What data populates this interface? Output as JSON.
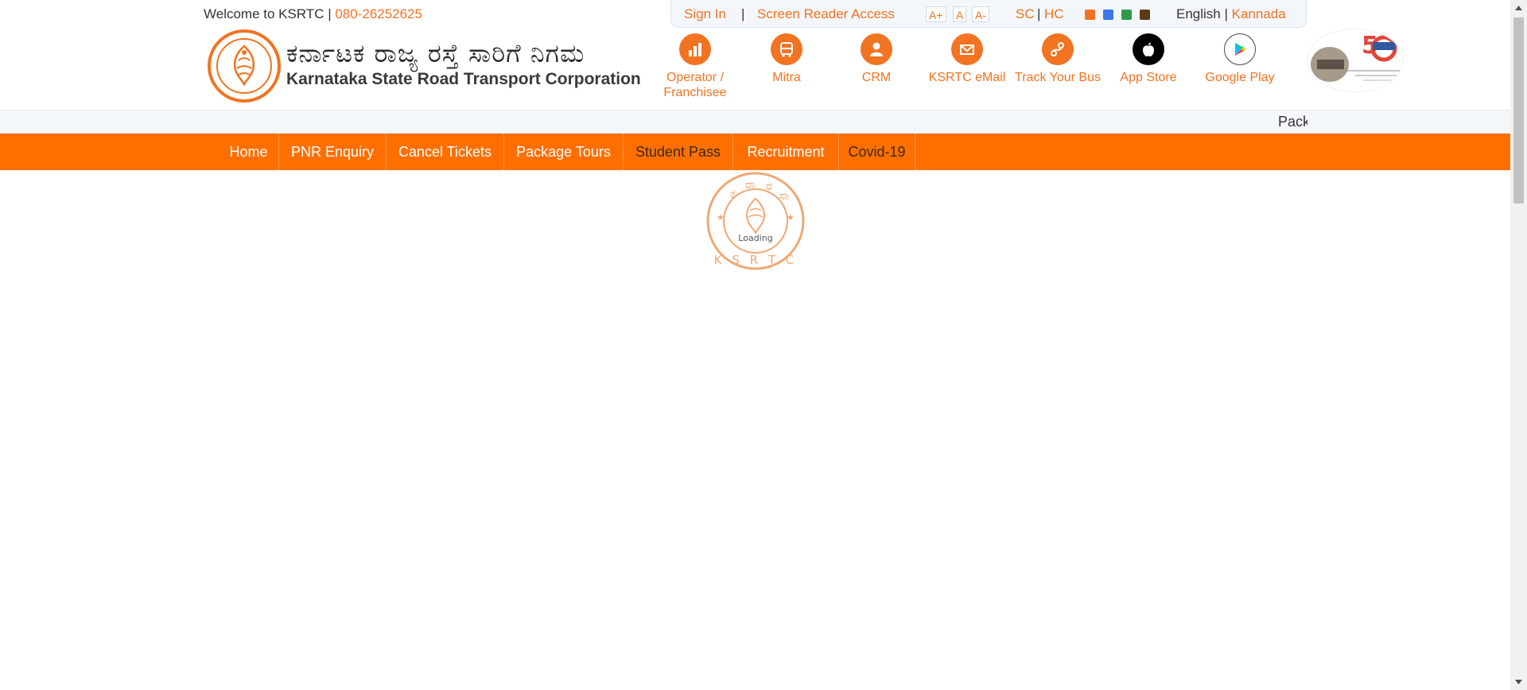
{
  "topbar": {
    "welcome": "Welcome to KSRTC | ",
    "phone": "080-26252625"
  },
  "utility": {
    "sign_in": "Sign In",
    "separator": "|",
    "screen_reader": "Screen Reader Access",
    "font_increase": "A+",
    "font_normal": "A",
    "font_decrease": "A-",
    "sc": "SC",
    "sep2": "|",
    "hc": "HC",
    "theme_colors": [
      "#f27321",
      "#3b78e7",
      "#2e9a4a",
      "#5a3a14"
    ],
    "lang_english": "English",
    "lang_sep": " | ",
    "lang_kannada": "Kannada"
  },
  "brand": {
    "name_kannada": "ಕರ್ನಾಟಕ ರಾಜ್ಯ ರಸ್ತೆ ಸಾರಿಗೆ ನಿಗಮ",
    "name_english": "Karnataka State Road Transport Corporation",
    "logo_text": "K. S. R. T. C."
  },
  "quick_links": [
    {
      "label": "Operator / Franchisee",
      "icon": "chart-icon"
    },
    {
      "label": "Mitra",
      "icon": "bus-icon"
    },
    {
      "label": "CRM",
      "icon": "user-icon"
    },
    {
      "label": "KSRTC eMail",
      "icon": "mail-icon"
    },
    {
      "label": "Track Your Bus",
      "icon": "route-icon"
    },
    {
      "label": "App Store",
      "icon": "apple-icon"
    },
    {
      "label": "Google Play",
      "icon": "play-store-icon"
    }
  ],
  "ticker": {
    "text": "Package Tours"
  },
  "nav": {
    "items": [
      {
        "label": "Home"
      },
      {
        "label": "PNR Enquiry"
      },
      {
        "label": "Cancel Tickets"
      },
      {
        "label": "Package Tours"
      },
      {
        "label": "Student Pass"
      },
      {
        "label": "Recruitment"
      },
      {
        "label": "Covid-19"
      }
    ]
  },
  "loader": {
    "text": "Loading",
    "seal_letters": "K S R T C"
  },
  "colors": {
    "brand_orange": "#f27321",
    "nav_orange": "#ff6f00"
  }
}
